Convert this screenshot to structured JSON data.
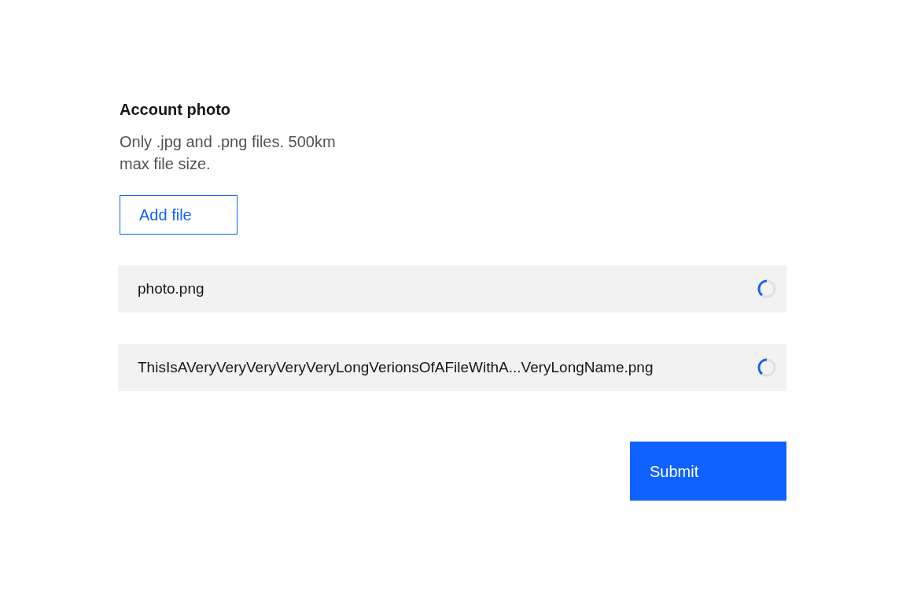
{
  "label": "Account photo",
  "description": "Only .jpg and .png files. 500km max file size.",
  "add_button": "Add file",
  "files": [
    {
      "name": "photo.png",
      "uploading": true
    },
    {
      "name": "ThisIsAVeryVeryVeryVeryVeryLongVerionsOfAFileWithA...VeryLongName.png",
      "uploading": true
    }
  ],
  "submit_button": "Submit"
}
